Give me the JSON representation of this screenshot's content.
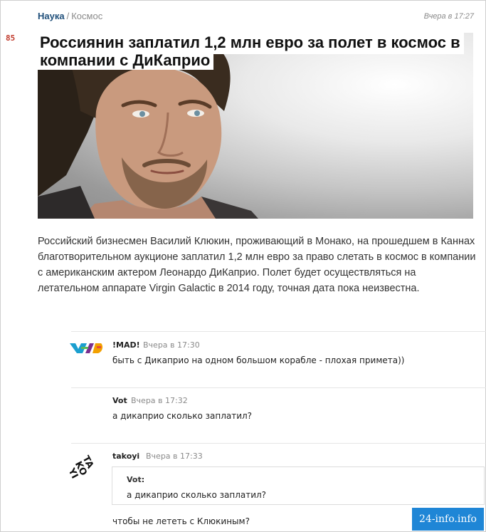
{
  "header": {
    "category": "Наука",
    "separator": "/",
    "subcategory": "Космос",
    "time": "Вчера в 17:27"
  },
  "article": {
    "rating": "85",
    "title_line1": "Россиянин заплатил 1,2 млн евро за полет в космос в",
    "title_line2": "компании с ДиКаприо",
    "body": "Российский бизнесмен Василий Клюкин, проживающий в Монако, на прошедшем в Каннах благотворительном аукционе заплатил 1,2 млн евро за право слетать в космос в компании с американским актером Леонардо ДиКаприо. Полет будет осуществляться на летательном аппарате Virgin Galactic в 2014 году, точная дата пока неизвестна."
  },
  "comments": [
    {
      "author": "!MAD!",
      "time": "Вчера в 17:30",
      "text": "быть с Дикаприо на одном большом корабле - плохая примета))"
    },
    {
      "author": "Vot",
      "time": "Вчера в 17:32",
      "text": "а дикаприо сколько заплатил?"
    },
    {
      "author": "takoyi",
      "time": "Вчера в 17:33",
      "quote_author": "Vot:",
      "quote_text": "а дикаприо сколько заплатил?",
      "text": "чтобы не лететь с Клюкиным?"
    }
  ],
  "watermark": "24-info.info",
  "colors": {
    "category_link": "#1f4f7a",
    "rating": "#c0392b",
    "watermark_bg": "#1f86d6"
  }
}
